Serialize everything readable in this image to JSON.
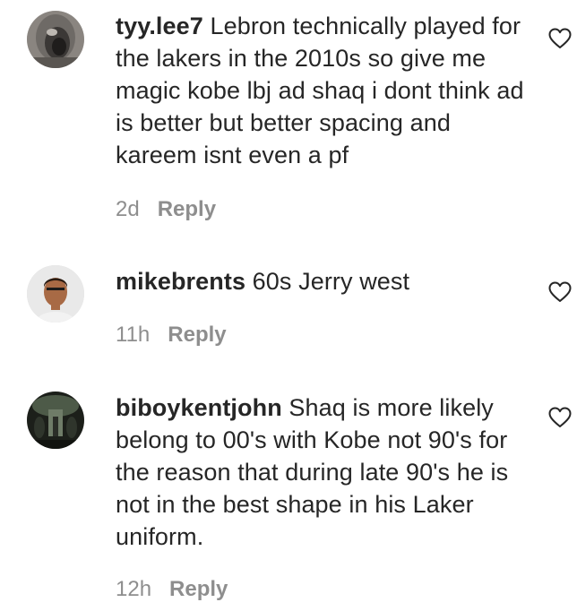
{
  "comments": [
    {
      "username": "tyy.lee7",
      "text": "Lebron technically played for the lakers in the 2010s so give me magic kobe lbj ad shaq i dont think ad is better but better spacing and kareem isnt even a pf",
      "time": "2d",
      "reply_label": "Reply",
      "avatar_icon": "user-avatar-photo",
      "like_icon": "heart-outline-icon"
    },
    {
      "username": "mikebrents",
      "text": "60s Jerry west",
      "time": "11h",
      "reply_label": "Reply",
      "avatar_icon": "user-avatar-photo",
      "like_icon": "heart-outline-icon"
    },
    {
      "username": "biboykentjohn",
      "text": "Shaq is more likely belong to 00's with Kobe not 90's for the reason that during late 90's he is not in the best shape in his Laker uniform.",
      "time": "12h",
      "reply_label": "Reply",
      "avatar_icon": "user-avatar-photo",
      "like_icon": "heart-outline-icon"
    }
  ],
  "colors": {
    "text": "#262626",
    "secondary": "#8e8e8e"
  }
}
